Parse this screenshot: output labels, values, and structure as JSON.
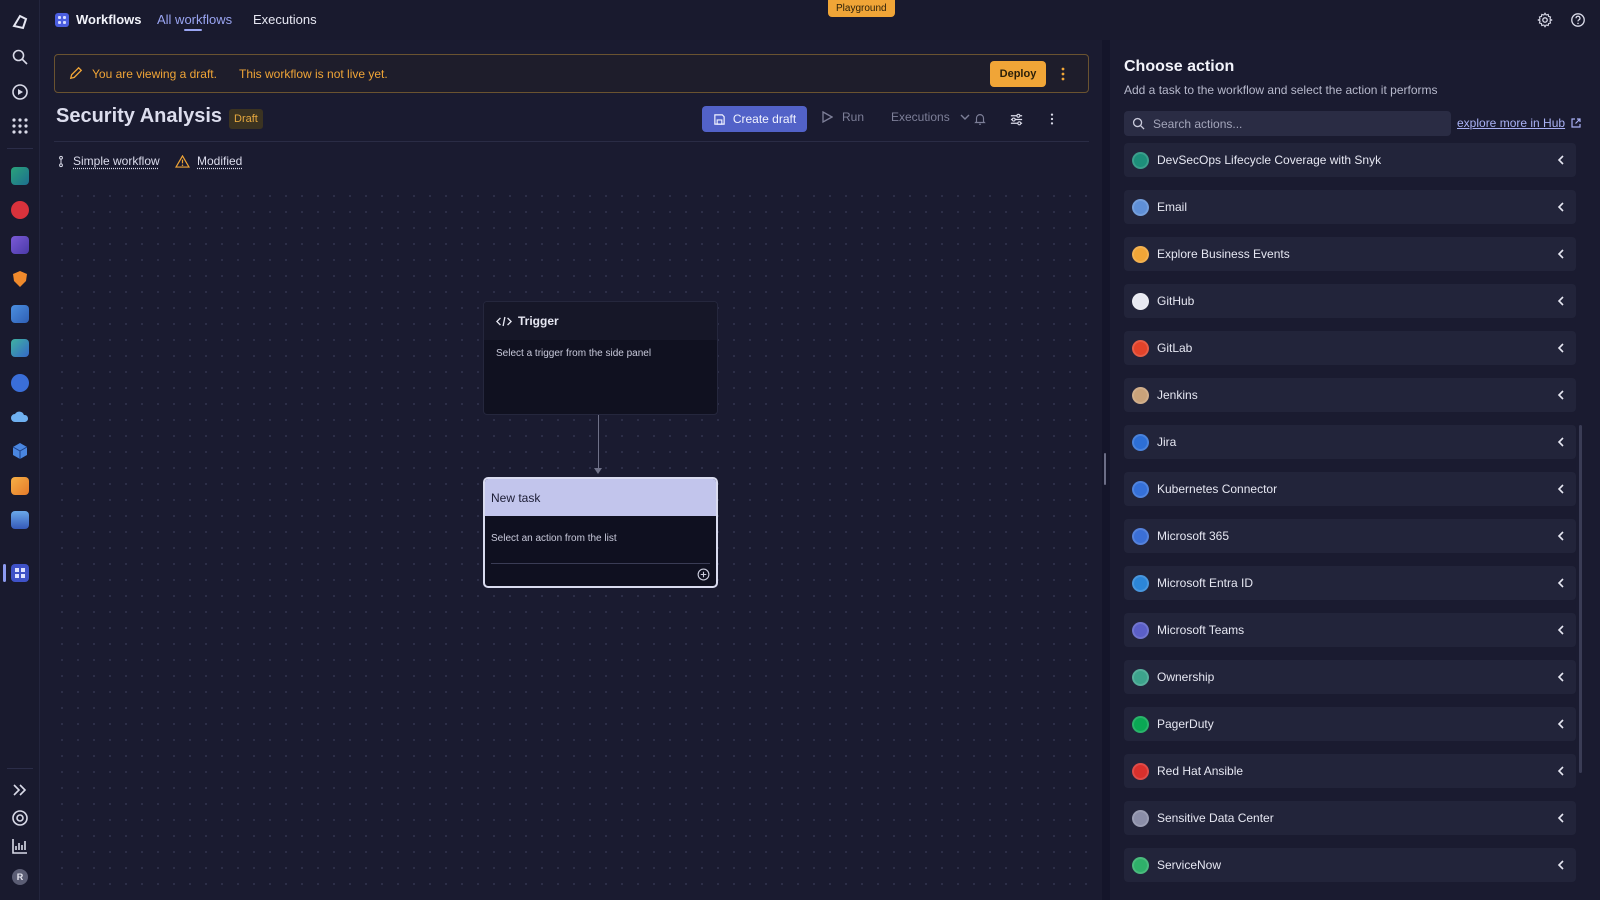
{
  "topbar": {
    "app_title": "Workflows",
    "tabs": [
      {
        "label": "All workflows",
        "active": true
      },
      {
        "label": "Executions",
        "active": false
      }
    ],
    "environment_badge": "Playground",
    "icons": [
      "gear-icon",
      "help-icon"
    ]
  },
  "rail": {
    "icons": [
      "logo-icon",
      "search-icon",
      "play-circle-icon",
      "apps-grid-icon",
      "dashboard-app-icon",
      "problems-app-icon",
      "package-app-icon",
      "security-shield-app-icon",
      "notebook-app-icon",
      "infrastructure-app-icon",
      "monitor-search-app-icon",
      "cloud-app-icon",
      "cube-app-icon",
      "delivery-app-icon",
      "database-app-icon",
      "workflows-app-icon"
    ],
    "bottom_icons": [
      "expand-icon",
      "support-icon",
      "reports-icon"
    ],
    "avatar_initial": "R"
  },
  "banner": {
    "strong": "You are viewing a draft.",
    "text": "This workflow is not live yet.",
    "deploy_label": "Deploy",
    "color": "#f0a537"
  },
  "workflow": {
    "title": "Security Analysis",
    "status_badge": "Draft",
    "create_draft_label": "Create draft",
    "run_label": "Run",
    "executions_label": "Executions",
    "type_label": "Simple workflow",
    "modified_label": "Modified"
  },
  "nodes": {
    "trigger": {
      "title": "Trigger",
      "hint": "Select a trigger from the side panel"
    },
    "task": {
      "title": "New task",
      "hint": "Select an action from the list"
    }
  },
  "panel": {
    "title": "Choose action",
    "subtitle": "Add a task to the workflow and select the action it performs",
    "search_placeholder": "Search actions...",
    "hub_link": "explore more in Hub",
    "actions": [
      {
        "label": "DevSecOps Lifecycle Coverage with Snyk",
        "icon": "snyk-icon",
        "color": "#1d8f7a"
      },
      {
        "label": "Email",
        "icon": "email-icon",
        "color": "#5f8fd6"
      },
      {
        "label": "Explore Business Events",
        "icon": "business-events-icon",
        "color": "#f0a537"
      },
      {
        "label": "GitHub",
        "icon": "github-icon",
        "color": "#e8e9f2"
      },
      {
        "label": "GitLab",
        "icon": "gitlab-icon",
        "color": "#e2432a"
      },
      {
        "label": "Jenkins",
        "icon": "jenkins-icon",
        "color": "#c9a27a"
      },
      {
        "label": "Jira",
        "icon": "jira-icon",
        "color": "#2d6fd6"
      },
      {
        "label": "Kubernetes Connector",
        "icon": "kubernetes-icon",
        "color": "#3570d8"
      },
      {
        "label": "Microsoft 365",
        "icon": "microsoft-365-icon",
        "color": "#3b6fd6"
      },
      {
        "label": "Microsoft Entra ID",
        "icon": "entra-id-icon",
        "color": "#2c86d8"
      },
      {
        "label": "Microsoft Teams",
        "icon": "teams-icon",
        "color": "#5b5fc7"
      },
      {
        "label": "Ownership",
        "icon": "ownership-icon",
        "color": "#3da38c"
      },
      {
        "label": "PagerDuty",
        "icon": "pagerduty-icon",
        "color": "#0aa854"
      },
      {
        "label": "Red Hat Ansible",
        "icon": "ansible-icon",
        "color": "#d9302c"
      },
      {
        "label": "Sensitive Data Center",
        "icon": "sensitive-data-icon",
        "color": "#8b8ea8"
      },
      {
        "label": "ServiceNow",
        "icon": "servicenow-icon",
        "color": "#2fb06a"
      }
    ]
  }
}
